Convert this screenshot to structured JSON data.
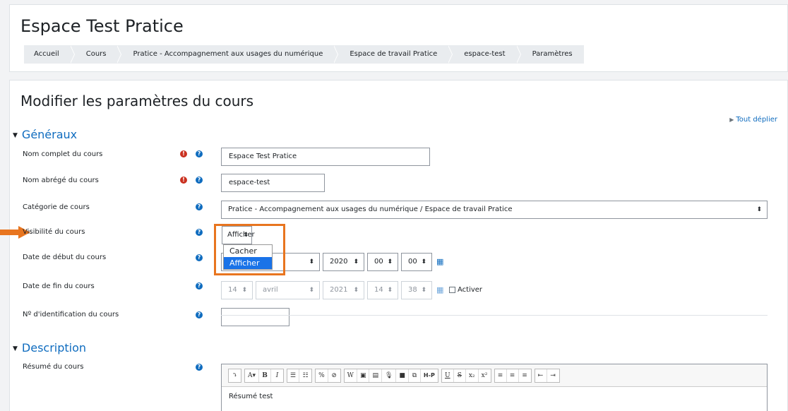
{
  "header": {
    "title": "Espace Test Pratice",
    "breadcrumb": [
      "Accueil",
      "Cours",
      "Pratice - Accompagnement aux usages du numérique",
      "Espace de travail Pratice",
      "espace-test",
      "Paramètres"
    ]
  },
  "form": {
    "title": "Modifier les paramètres du cours",
    "expand_all": "Tout déplier",
    "sections": {
      "general": "Généraux",
      "description": "Description"
    },
    "fields": {
      "fullname": {
        "label": "Nom complet du cours",
        "value": "Espace Test Pratice"
      },
      "shortname": {
        "label": "Nom abrégé du cours",
        "value": "espace-test"
      },
      "category": {
        "label": "Catégorie de cours",
        "value": "Pratice - Accompagnement aux usages du numérique / Espace de travail Pratice"
      },
      "visibility": {
        "label": "Visibilité du cours",
        "value": "Afficher",
        "options": [
          "Cacher",
          "Afficher"
        ]
      },
      "startdate": {
        "label": "Date de début du cours",
        "month_partial": "ars",
        "year": "2020",
        "hour": "00",
        "minute": "00"
      },
      "enddate": {
        "label": "Date de fin du cours",
        "day": "14",
        "month": "avril",
        "year": "2021",
        "hour": "14",
        "minute": "38",
        "enable_label": "Activer"
      },
      "idnumber": {
        "label": "Nº d'identification du cours",
        "value": ""
      },
      "summary": {
        "label": "Résumé du cours",
        "value": "Résumé test"
      }
    }
  },
  "icons": {
    "required": "exclamation-icon",
    "help": "question-icon",
    "calendar": "calendar-icon"
  },
  "toolbar": {
    "groups": [
      [
        "⤵"
      ],
      [
        "A▾",
        "B",
        "I"
      ],
      [
        "☰",
        "☷"
      ],
      [
        "%",
        "⊘"
      ],
      [
        "W",
        "▣",
        "▤",
        "🎙",
        "■",
        "⧉",
        "H-P"
      ],
      [
        "U",
        "S",
        "x₂",
        "x²"
      ],
      [
        "≡",
        "≡",
        "≡"
      ],
      [
        "⇤",
        "⇥"
      ]
    ]
  },
  "colors": {
    "accent": "#0f6cbf",
    "required": "#ca3120",
    "highlight": "#e8751f",
    "selected_option": "#1a73e8"
  }
}
